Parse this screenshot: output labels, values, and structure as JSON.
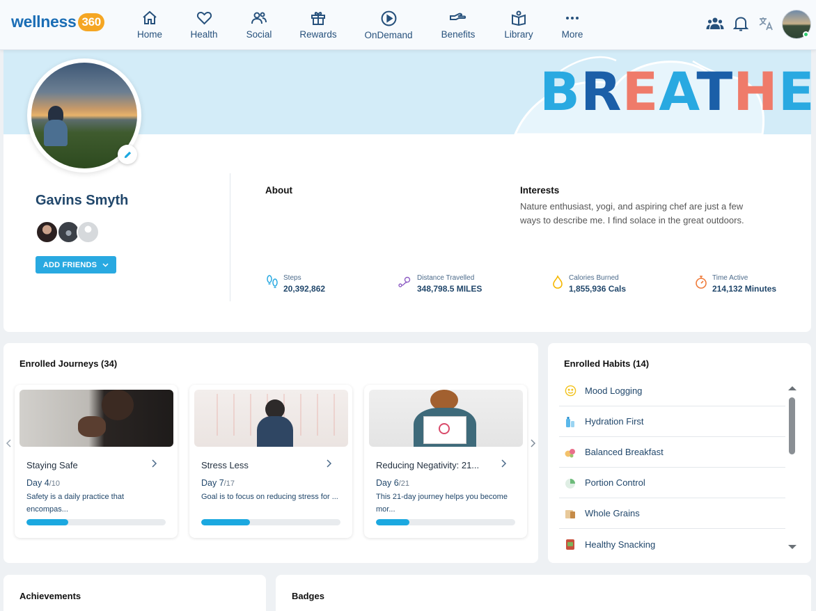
{
  "brand": {
    "name": "wellness",
    "num": "360"
  },
  "nav": [
    {
      "label": "Home",
      "icon": "home-icon"
    },
    {
      "label": "Health",
      "icon": "heart-icon"
    },
    {
      "label": "Social",
      "icon": "people-icon"
    },
    {
      "label": "Rewards",
      "icon": "gift-icon"
    },
    {
      "label": "OnDemand",
      "icon": "play-circle-icon"
    },
    {
      "label": "Benefits",
      "icon": "hand-icon"
    },
    {
      "label": "Library",
      "icon": "book-icon"
    },
    {
      "label": "More",
      "icon": "dots-icon"
    }
  ],
  "banner": {
    "text": "BREATHE"
  },
  "profile": {
    "name": "Gavins Smyth",
    "add_friends": "ADD FRIENDS",
    "about_h": "About",
    "interests_h": "Interests",
    "interests": "Nature enthusiast, yogi, and aspiring chef are just a few ways to describe me. I find solace in the great outdoors."
  },
  "stats": [
    {
      "label": "Steps",
      "value": "20,392,862",
      "icon": "footsteps-icon"
    },
    {
      "label": "Distance Travelled",
      "value": "348,798.5 MILES",
      "icon": "route-icon"
    },
    {
      "label": "Calories Burned",
      "value": "1,855,936 Cals",
      "icon": "flame-icon"
    },
    {
      "label": "Time Active",
      "value": "214,132 Minutes",
      "icon": "stopwatch-icon"
    }
  ],
  "journeys": {
    "title": "Enrolled Journeys (34)",
    "items": [
      {
        "title": "Staying Safe",
        "day": "Day 4",
        "total": "/10",
        "desc": "Safety is a daily practice that encompas...",
        "progress": 0.3
      },
      {
        "title": "Stress Less",
        "day": "Day 7",
        "total": "/17",
        "desc": "Goal is to focus on reducing stress for ...",
        "progress": 0.35
      },
      {
        "title": "Reducing Negativity: 21...",
        "day": "Day 6",
        "total": "/21",
        "desc": "This 21-day journey helps you become mor...",
        "progress": 0.24
      }
    ]
  },
  "habits": {
    "title": "Enrolled Habits (14)",
    "items": [
      {
        "label": "Mood Logging",
        "icon": "smiley-icon"
      },
      {
        "label": "Hydration First",
        "icon": "water-bottle-icon"
      },
      {
        "label": "Balanced Breakfast",
        "icon": "breakfast-icon"
      },
      {
        "label": "Portion Control",
        "icon": "portion-icon"
      },
      {
        "label": "Whole Grains",
        "icon": "grains-icon"
      },
      {
        "label": "Healthy Snacking",
        "icon": "snack-icon"
      }
    ]
  },
  "achievements": {
    "title": "Achievements"
  },
  "badges": {
    "title": "Badges"
  },
  "colors": {
    "accent": "#29a9e1",
    "navy": "#21476b",
    "banner": "#d3ecf8"
  }
}
